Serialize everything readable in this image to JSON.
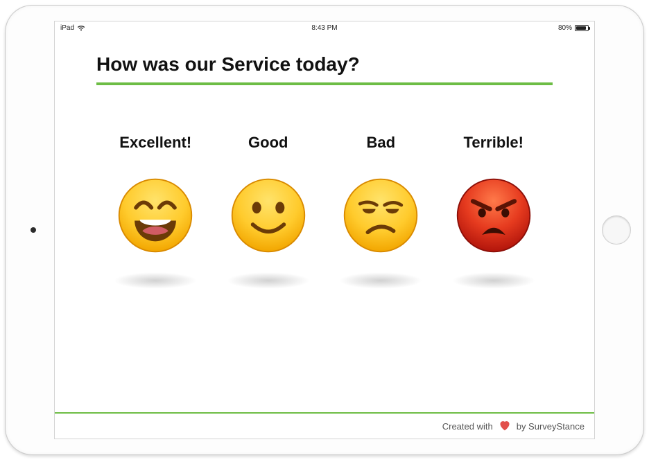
{
  "statusbar": {
    "device": "iPad",
    "time": "8:43 PM",
    "battery_pct": "80%"
  },
  "survey": {
    "question": "How was our Service today?",
    "options": [
      {
        "label": "Excellent!",
        "emoji": "excellent-icon"
      },
      {
        "label": "Good",
        "emoji": "good-icon"
      },
      {
        "label": "Bad",
        "emoji": "bad-icon"
      },
      {
        "label": "Terrible!",
        "emoji": "terrible-icon"
      }
    ]
  },
  "footer": {
    "prefix": "Created with",
    "suffix": "by SurveyStance"
  },
  "colors": {
    "accent": "#6dbd45",
    "heart": "#e2504c"
  }
}
